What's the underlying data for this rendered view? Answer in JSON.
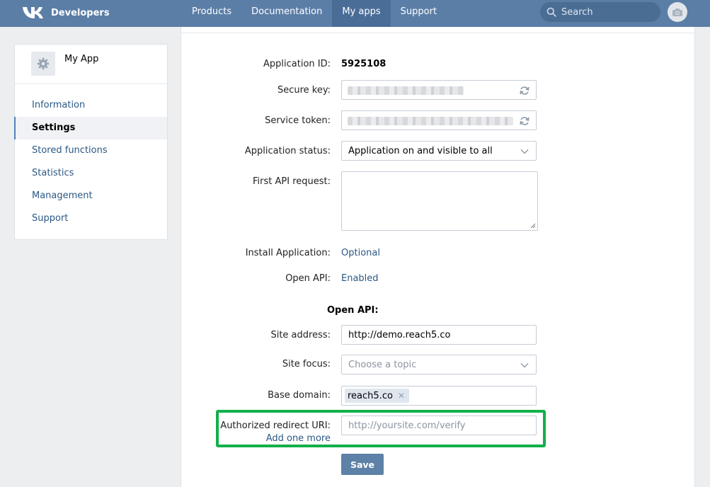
{
  "header": {
    "brand": "Developers",
    "nav": [
      {
        "label": "Products"
      },
      {
        "label": "Documentation"
      },
      {
        "label": "My apps"
      },
      {
        "label": "Support"
      }
    ],
    "search_placeholder": "Search"
  },
  "sidebar": {
    "app_name": "My App",
    "items": [
      {
        "label": "Information"
      },
      {
        "label": "Settings"
      },
      {
        "label": "Stored functions"
      },
      {
        "label": "Statistics"
      },
      {
        "label": "Management"
      },
      {
        "label": "Support"
      }
    ]
  },
  "form": {
    "app_id_label": "Application ID:",
    "app_id_value": "5925108",
    "secure_key_label": "Secure key:",
    "service_token_label": "Service token:",
    "status_label": "Application status:",
    "status_value": "Application on and visible to all",
    "first_request_label": "First API request:",
    "install_label": "Install Application:",
    "install_value": "Optional",
    "open_api_label": "Open API:",
    "open_api_value": "Enabled",
    "open_api_section": "Open API:",
    "site_address_label": "Site address:",
    "site_address_value": "http://demo.reach5.co",
    "site_focus_label": "Site focus:",
    "site_focus_placeholder": "Choose a topic",
    "base_domain_label": "Base domain:",
    "base_domain_tag": "reach5.co",
    "redirect_label": "Authorized redirect URI:",
    "redirect_placeholder": "http://yoursite.com/verify",
    "add_more": "Add one more",
    "save": "Save"
  },
  "colors": {
    "header_bg": "#5b7ea7",
    "link": "#2a5885",
    "highlight_border": "#12b04a",
    "button_bg": "#5e81a8"
  }
}
